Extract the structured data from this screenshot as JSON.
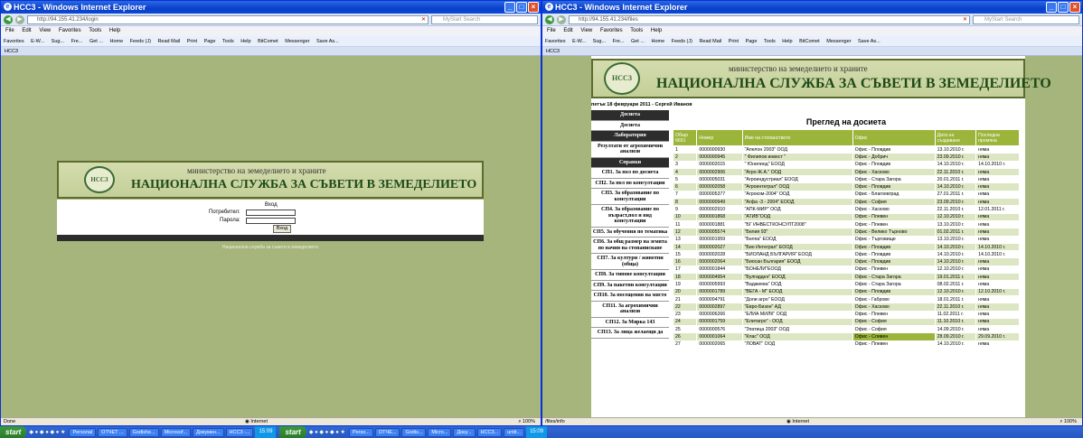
{
  "left": {
    "title": "HCC3 - Windows Internet Explorer",
    "address": "http://94.155.41.234/login",
    "search_placeholder": "MyStart Search",
    "menu": [
      "File",
      "Edit",
      "View",
      "Favorites",
      "Tools",
      "Help"
    ],
    "favorites": [
      "Favorites",
      "E-W...",
      "Sug...",
      "Fre...",
      "Get ...",
      "Home",
      "Feeds (J)",
      "Read Mail",
      "Print",
      "Page",
      "Tools",
      "Help",
      "BitComet",
      "Messenger",
      "Save As..."
    ],
    "tab": "HCC3",
    "ministry": "министерство на земеделието и храните",
    "agency": "НАЦИОНАЛНА СЛУЖБА ЗА СЪВЕТИ В ЗЕМЕДЕЛИЕТО",
    "logo": "НССЗ",
    "login_title": "Вход",
    "user_label": "Потребител:",
    "pass_label": "Парола:",
    "login_button": "Вход",
    "footer": "Национална служба за съвети в земеделието",
    "status": "Done",
    "zone": "Internet",
    "zoom": "100%"
  },
  "right": {
    "title": "HCC3 - Windows Internet Explorer",
    "address": "http://94.155.41.234/files",
    "search_placeholder": "MyStart Search",
    "menu": [
      "File",
      "Edit",
      "View",
      "Favorites",
      "Tools",
      "Help"
    ],
    "favorites": [
      "Favorites",
      "E-W...",
      "Sug...",
      "Fre...",
      "Get ...",
      "Home",
      "Feeds (J)",
      "Read Mail",
      "Print",
      "Page",
      "Tools",
      "Help",
      "BitComet",
      "Messenger",
      "Save As..."
    ],
    "tab": "HCC3",
    "ministry": "министерство на земеделието и храните",
    "agency": "НАЦИОНАЛНА СЛУЖБА ЗА СЪВЕТИ В ЗЕМЕДЕЛИЕТО",
    "logo": "НССЗ",
    "dateline": "петък 18 февруари 2011 - Сергей Иванов",
    "sidebar": [
      {
        "label": "Досиета",
        "dark": true
      },
      {
        "label": "Досиета",
        "dark": false
      },
      {
        "label": "Лаборатория",
        "dark": true
      },
      {
        "label": "Резултати от агрохимични анализи",
        "dark": false
      },
      {
        "label": "Справки",
        "dark": true
      },
      {
        "label": "СП1. За пол по досиета",
        "dark": false
      },
      {
        "label": "СП2. За пол по консултации",
        "dark": false
      },
      {
        "label": "СП3. За образование по консултации",
        "dark": false
      },
      {
        "label": "СП4. За образование по възраст,пол и вид консултации",
        "dark": false
      },
      {
        "label": "СП5. За обучения по тематика",
        "dark": false
      },
      {
        "label": "СП6. За общ размер на земята по начин на стопанисване",
        "dark": false
      },
      {
        "label": "СП7. За култури / животни (обща)",
        "dark": false
      },
      {
        "label": "СП8. За типове консултации",
        "dark": false
      },
      {
        "label": "СП9. За пакетни консултации",
        "dark": false
      },
      {
        "label": "СП10. За посещения на място",
        "dark": false
      },
      {
        "label": "СП11. За агрохимични анализи",
        "dark": false
      },
      {
        "label": "СП12. За Мярка 143",
        "dark": false
      },
      {
        "label": "СП13. За лица желаещи да",
        "dark": false
      }
    ],
    "page_title": "Преглед на досиета",
    "columns": [
      "Общо 6651",
      "Номер",
      "Име на стопанството",
      "Офис",
      "Дата на създаване",
      "Последна промяна"
    ],
    "rows": [
      [
        "1",
        "0000000930",
        "\"Апелон 2003\" ООД",
        "Офис - Пловдив",
        "13.10.2010 г.",
        "няма"
      ],
      [
        "2",
        "0000000945",
        "\" Филипов инвест \"",
        "Офис - Добрич",
        "23.09.2010 г.",
        "няма"
      ],
      [
        "3",
        "0000002015",
        "\" Юнилинд\" ЕООД",
        "Офис - Пловдив",
        "14.10.2010 г.",
        "14.10.2010 г."
      ],
      [
        "4",
        "0000002906",
        "\"Агро-Ж.А.\" ООД",
        "Офис - Хасково",
        "22.11.2010 г.",
        "няма"
      ],
      [
        "5",
        "0000005031",
        "\"Агроиндустриал\" ЕООД",
        "Офис - Стара Загора",
        "20.01.2011 г.",
        "няма"
      ],
      [
        "6",
        "0000002058",
        "\"Агроинтеграл\" ООД",
        "Офис - Пловдив",
        "14.10.2010 г.",
        "няма"
      ],
      [
        "7",
        "0000005377",
        "\"Агроком-2004\" ООД",
        "Офис - Благоевград",
        "27.01.2011 г.",
        "няма"
      ],
      [
        "8",
        "0000000949",
        "\"Агфа -3 - 2004\" ЕООД",
        "Офис - София",
        "23.09.2010 г.",
        "няма"
      ],
      [
        "9",
        "0000002910",
        "\"АПК-МИР\" ООД",
        "Офис - Хасково",
        "22.11.2010 г.",
        "12.01.2011 г."
      ],
      [
        "10",
        "0000001868",
        "\"АТИВ\"ООД",
        "Офис - Плевен",
        "12.10.2010 г.",
        "няма"
      ],
      [
        "11",
        "0000001881",
        "\"БГ ИНВЕСТКОНСУЛТ2008\"",
        "Офис - Плевен",
        "13.10.2010 г.",
        "няма"
      ],
      [
        "12",
        "0000005574",
        "\"Белия 93\"",
        "Офис - Велико Търново",
        "01.02.2011 г.",
        "няма"
      ],
      [
        "13",
        "0000001959",
        "\"Белпа\" ЕООД",
        "Офис - Търговище",
        "13.10.2010 г.",
        "няма"
      ],
      [
        "14",
        "0000002027",
        "\"Био Интеграл\" ЕООД",
        "Офис - Пловдив",
        "14.10.2010 г.",
        "14.10.2010 г."
      ],
      [
        "15",
        "0000002028",
        "\"БИОЛАНД БЪЛГАРИЯ\" ЕООД",
        "Офис - Пловдив",
        "14.10.2010 г.",
        "14.10.2010 г."
      ],
      [
        "16",
        "0000002064",
        "\"Биосан България\" ЕООД",
        "Офис - Пловдив",
        "14.10.2010 г.",
        "няма"
      ],
      [
        "17",
        "0000001844",
        "\"БОНЕЛИ\"ЕООД",
        "Офис - Плевен",
        "12.10.2010 г.",
        "няма"
      ],
      [
        "18",
        "0000004954",
        "\"Булгарден\" ЕООД",
        "Офис - Стара Загора",
        "19.01.2011 г.",
        "няма"
      ],
      [
        "19",
        "0000005993",
        "\"Ваджиева\" ООД",
        "Офис - Стара Загора",
        "08.02.2011 г.",
        "няма"
      ],
      [
        "20",
        "0000001789",
        "\"ВЕГА - М\" ЕООД",
        "Офис - Пловдив",
        "12.10.2010 г.",
        "12.10.2010 г."
      ],
      [
        "21",
        "0000004791",
        "\"Доли агро\" ЕООД",
        "Офис - Габрово",
        "18.01.2011 г.",
        "няма"
      ],
      [
        "22",
        "0000002897",
        "\"Евро-Бизон\" АД",
        "Офис - Хасково",
        "22.11.2010 г.",
        "няма"
      ],
      [
        "23",
        "0000006266",
        "\"ЕЛИА МИЛК\" ООД",
        "Офис - Плевен",
        "11.02.2011 г.",
        "няма"
      ],
      [
        "24",
        "0000001759",
        "\"Елитагро\" - ООД",
        "Офис - София",
        "11.10.2010 г.",
        "няма"
      ],
      [
        "25",
        "0000000576",
        "\"Зпатица 2003\" ООД",
        "Офис - София",
        "14.09.2010 г.",
        "няма"
      ],
      [
        "26",
        "0000001064",
        "\"Клас\" ООД",
        "Офис - Сливен",
        "28.09.2010 г.",
        "29.09.2010 г."
      ],
      [
        "27",
        "0000002065",
        "\"ЛОВАТ\" ООД",
        "Офис - Плевен",
        "14.10.2010 г.",
        "няма"
      ]
    ],
    "status": "/files/info",
    "zone": "Internet",
    "zoom": "100%"
  },
  "taskbar": {
    "start": "start",
    "items_left": [
      "Personal",
      "ОТЧЕТ ...",
      "Godishe...",
      "Microsof...",
      "Докумен...",
      "HCC3 -..."
    ],
    "clock_left": "15:09",
    "items_right": [
      "Perso...",
      "ОТЧЕ...",
      "Godis...",
      "Micro...",
      "Доку...",
      "HCC3...",
      "untit..."
    ],
    "clock_right": "15:09"
  }
}
